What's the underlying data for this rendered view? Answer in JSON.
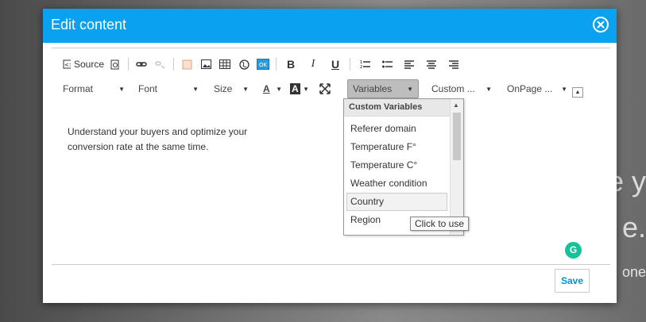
{
  "modal": {
    "title": "Edit content"
  },
  "toolbar": {
    "source_label": "Source",
    "format_label": "Format",
    "font_label": "Font",
    "size_label": "Size",
    "variables_label": "Variables",
    "custom_label": "Custom ...",
    "onpage_label": "OnPage ..."
  },
  "content": {
    "text_line1": "Understand your buyers and optimize your",
    "text_line2": "conversion rate at the same time."
  },
  "variables_dropdown": {
    "header": "Custom Variables",
    "items": [
      "Referer domain",
      "Temperature F°",
      "Temperature C°",
      "Weather condition",
      "Country",
      "Region"
    ],
    "highlighted_item": "Country"
  },
  "tooltip": {
    "text": "Click to use"
  },
  "footer": {
    "save_label": "Save"
  },
  "background": {
    "text1": "e y",
    "text2": "e.",
    "text3": "one"
  },
  "colors": {
    "header": "#0aa1f0",
    "save_text": "#0a8fd8"
  }
}
